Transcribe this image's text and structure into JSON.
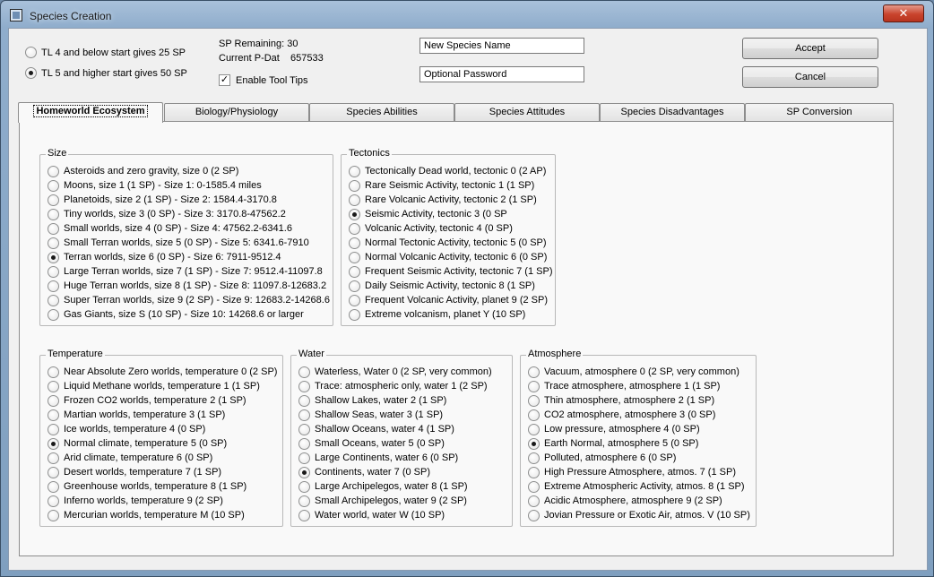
{
  "window": {
    "title": "Species Creation",
    "close_label": "✕"
  },
  "start": {
    "option1": "TL 4 and below start gives 25 SP",
    "option2": "TL 5 and higher start gives 50 SP",
    "selected": 1
  },
  "stats": {
    "sp_remaining": "SP Remaining: 30",
    "current_pdat_label": "Current P-Dat",
    "current_pdat_value": "657533",
    "tooltips_label": "Enable Tool Tips",
    "tooltips_checked": true
  },
  "fields": {
    "species_name": "New Species Name",
    "password": "Optional Password"
  },
  "buttons": {
    "accept": "Accept",
    "cancel": "Cancel"
  },
  "tabs": [
    "Homeworld Ecosystem",
    "Biology/Physiology",
    "Species Abilities",
    "Species Attitudes",
    "Species Disadvantages",
    "SP Conversion"
  ],
  "active_tab": 0,
  "groups": {
    "size": {
      "title": "Size",
      "selected": 6,
      "options": [
        "Asteroids and zero gravity, size 0 (2 SP)",
        "Moons, size 1 (1 SP) - Size 1:  0-1585.4 miles",
        "Planetoids, size 2 (1 SP) - Size 2:  1584.4-3170.8",
        "Tiny worlds, size 3 (0 SP) - Size 3:  3170.8-47562.2",
        "Small worlds, size 4 (0 SP) - Size 4:  47562.2-6341.6",
        "Small Terran worlds, size 5 (0 SP) - Size 5:  6341.6-7910",
        "Terran worlds, size 6 (0 SP) - Size 6:  7911-9512.4",
        "Large Terran worlds, size 7 (1 SP) - Size 7:  9512.4-11097.8",
        "Huge Terran worlds, size 8 (1 SP) - Size 8:  11097.8-12683.2",
        "Super Terran worlds, size 9 (2 SP) - Size 9:  12683.2-14268.6",
        "Gas Giants, size S (10 SP) - Size 10:  14268.6 or larger"
      ]
    },
    "tectonics": {
      "title": "Tectonics",
      "selected": 3,
      "options": [
        "Tectonically Dead world, tectonic 0 (2 AP)",
        "Rare Seismic Activity, tectonic 1 (1 SP)",
        "Rare Volcanic Activity, tectonic 2 (1 SP)",
        "Seismic Activity, tectonic 3 (0 SP",
        "Volcanic Activity, tectonic 4 (0 SP)",
        "Normal Tectonic Activity, tectonic 5 (0 SP)",
        "Normal Volcanic Activity, tectonic 6 (0 SP)",
        "Frequent Seismic Activity, tectonic 7 (1 SP)",
        "Daily Seismic Activity, tectonic 8 (1 SP)",
        "Frequent Volcanic Activity, planet 9 (2 SP)",
        "Extreme volcanism, planet Y (10 SP)"
      ]
    },
    "temperature": {
      "title": "Temperature",
      "selected": 5,
      "options": [
        "Near Absolute Zero worlds, temperature 0 (2 SP)",
        "Liquid Methane worlds, temperature 1 (1 SP)",
        "Frozen CO2 worlds, temperature 2 (1 SP)",
        "Martian worlds, temperature 3 (1 SP)",
        "Ice worlds, temperature 4 (0 SP)",
        "Normal climate, temperature 5 (0 SP)",
        "Arid climate, temperature 6 (0 SP)",
        "Desert worlds, temperature 7 (1 SP)",
        "Greenhouse worlds, temperature 8 (1 SP)",
        "Inferno worlds, temperature 9 (2 SP)",
        "Mercurian worlds, temperature M (10 SP)"
      ]
    },
    "water": {
      "title": "Water",
      "selected": 7,
      "options": [
        "Waterless, Water 0 (2 SP, very common)",
        "Trace: atmospheric only, water 1 (2 SP)",
        "Shallow Lakes, water 2 (1 SP)",
        "Shallow Seas, water 3 (1 SP)",
        "Shallow Oceans, water 4 (1 SP)",
        "Small Oceans, water 5 (0 SP)",
        "Large Continents, water 6 (0 SP)",
        "Continents, water 7 (0 SP)",
        "Large Archipelegos, water 8 (1 SP)",
        "Small Archipelegos, water 9 (2 SP)",
        "Water world, water W (10 SP)"
      ]
    },
    "atmosphere": {
      "title": "Atmosphere",
      "selected": 5,
      "options": [
        "Vacuum, atmosphere 0 (2 SP, very common)",
        "Trace atmosphere, atmosphere 1 (1 SP)",
        "Thin atmosphere, atmosphere 2 (1 SP)",
        "CO2 atmosphere, atmosphere 3 (0 SP)",
        "Low pressure, atmosphere 4 (0 SP)",
        "Earth Normal, atmosphere 5 (0 SP)",
        "Polluted, atmosphere 6 (0 SP)",
        "High Pressure Atmosphere, atmos. 7 (1 SP)",
        "Extreme Atmospheric Activity, atmos. 8 (1 SP)",
        "Acidic Atmosphere, atmosphere 9 (2 SP)",
        "Jovian Pressure or Exotic Air, atmos. V (10 SP)"
      ]
    }
  }
}
